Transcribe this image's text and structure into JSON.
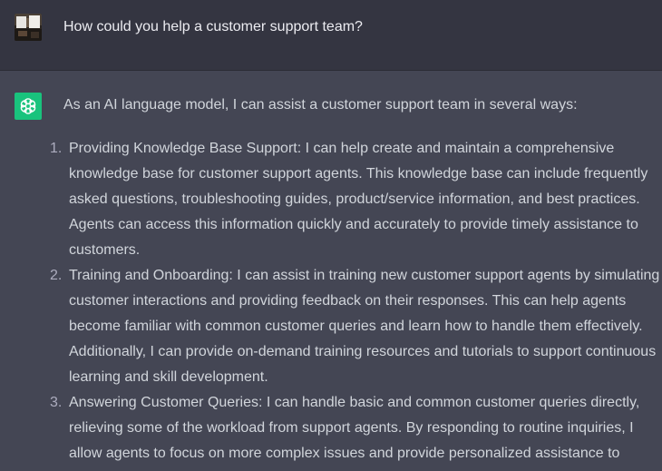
{
  "user_message": {
    "text": "How could you help a customer support team?"
  },
  "assistant_message": {
    "intro": "As an AI language model, I can assist a customer support team in several ways:",
    "items": [
      {
        "number": "1.",
        "text": "Providing Knowledge Base Support: I can help create and maintain a comprehensive knowledge base for customer support agents. This knowledge base can include frequently asked questions, troubleshooting guides, product/service information, and best practices. Agents can access this information quickly and accurately to provide timely assistance to customers."
      },
      {
        "number": "2.",
        "text": "Training and Onboarding: I can assist in training new customer support agents by simulating customer interactions and providing feedback on their responses. This can help agents become familiar with common customer queries and learn how to handle them effectively. Additionally, I can provide on-demand training resources and tutorials to support continuous learning and skill development."
      },
      {
        "number": "3.",
        "text": "Answering Customer Queries: I can handle basic and common customer queries directly, relieving some of the workload from support agents. By responding to routine inquiries, I allow agents to focus on more complex issues and provide personalized assistance to"
      }
    ]
  },
  "colors": {
    "user_bg": "#343541",
    "assistant_bg": "#444654",
    "bot_avatar": "#19c37d",
    "text": "#d1d5db"
  },
  "icons": {
    "user_avatar": "user-avatar-photo",
    "bot_avatar": "openai-logo-icon"
  }
}
